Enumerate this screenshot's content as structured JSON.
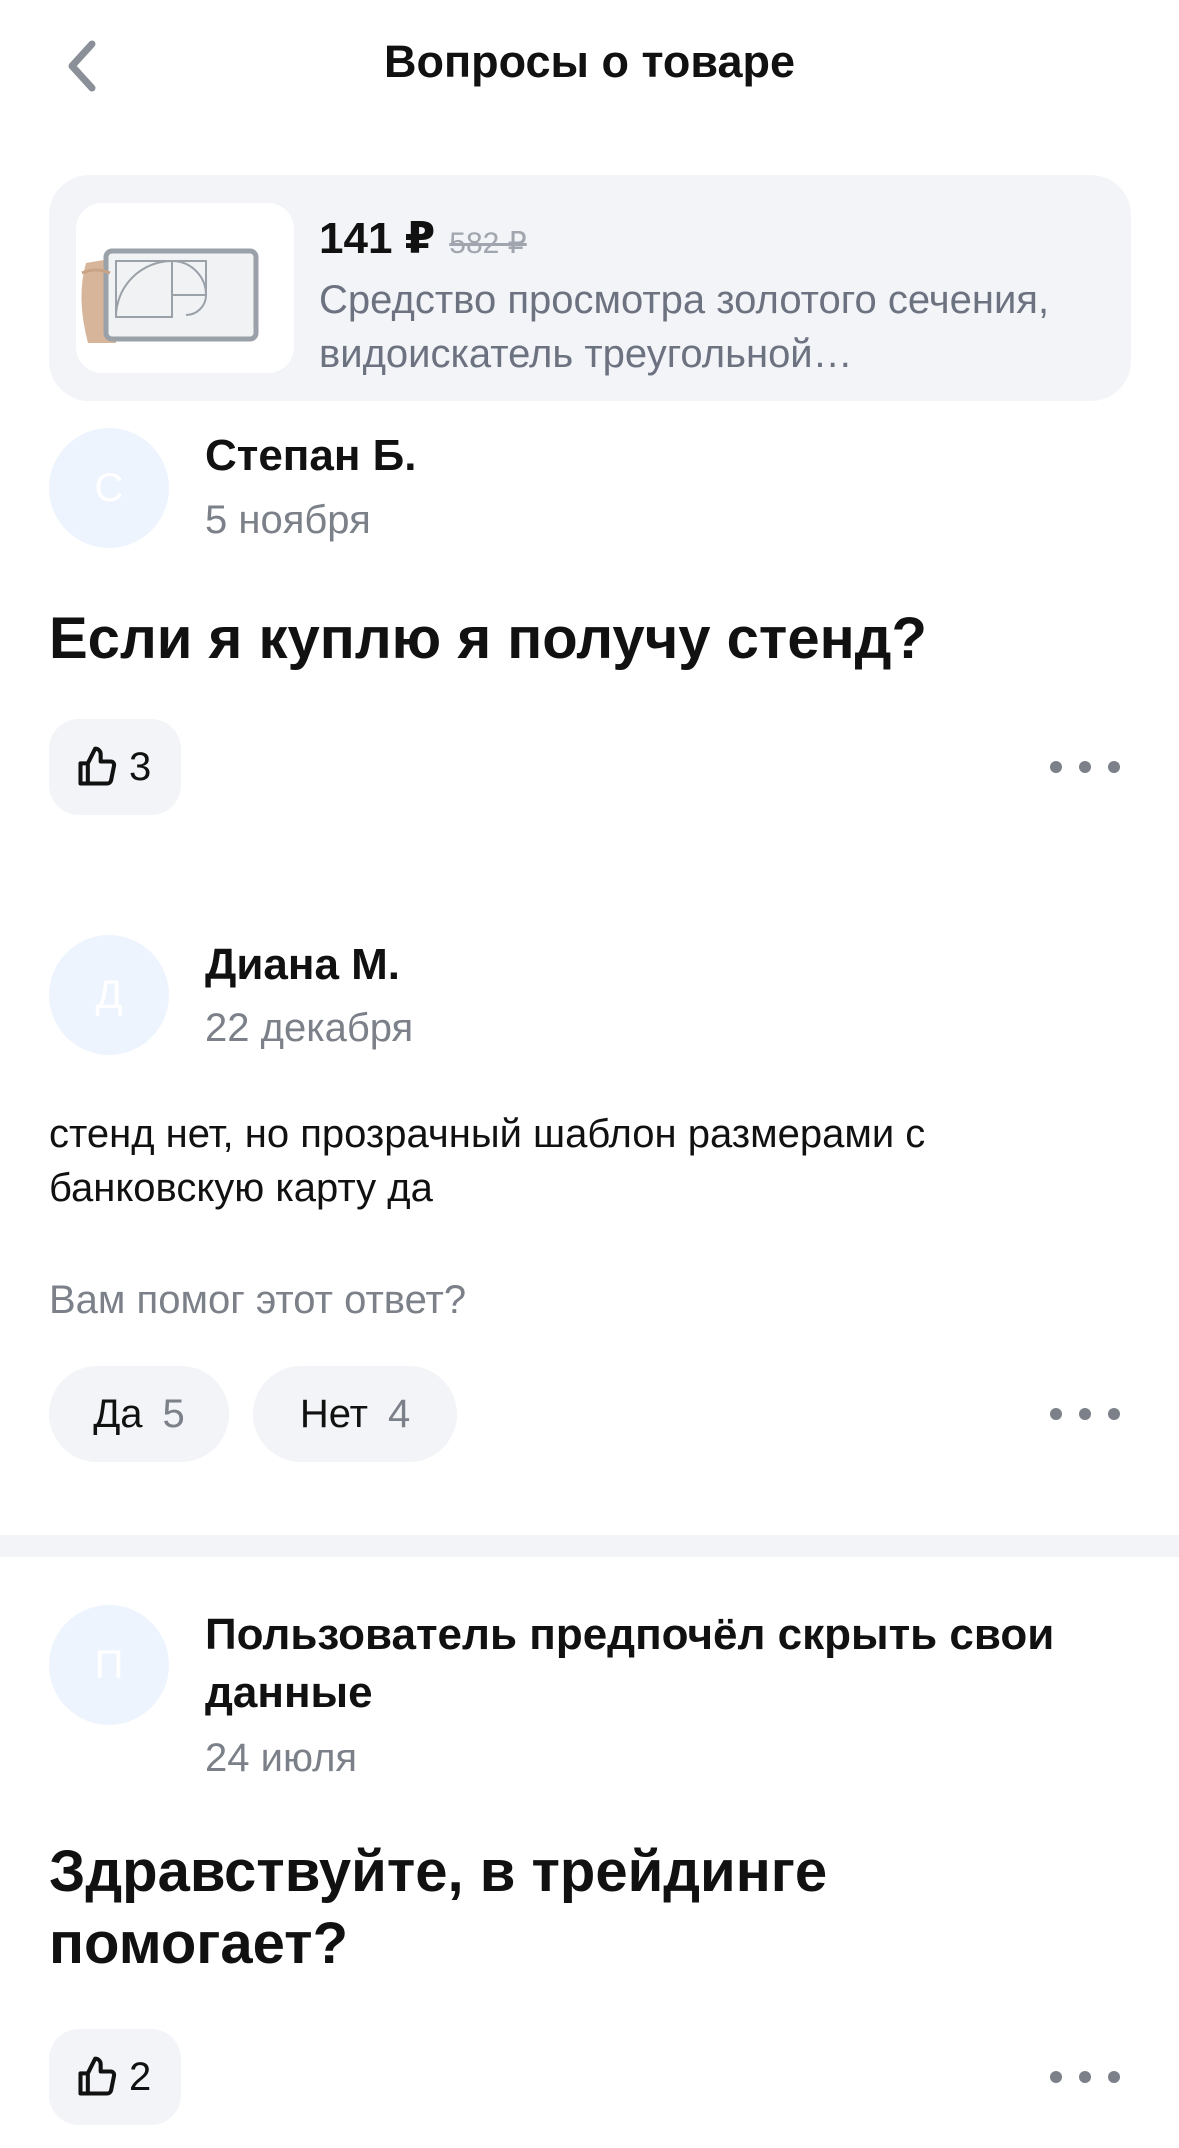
{
  "header": {
    "title": "Вопросы о товаре"
  },
  "product": {
    "price": "141 ₽",
    "old_price": "582 ₽",
    "name": "Средство просмотра золотого сечения, видоискатель треугольной…"
  },
  "items": [
    {
      "type": "question",
      "avatar_letter": "С",
      "author": "Степан Б.",
      "date": "5 ноября",
      "text": "Если я куплю я получу стенд?",
      "likes": "3"
    },
    {
      "type": "answer",
      "avatar_letter": "Д",
      "author": "Диана М.",
      "date": "22 декабря",
      "text": "стенд нет, но прозрачный шаблон размерами с банковскую карту да",
      "helpful_label": "Вам помог этот ответ?",
      "yes_label": "Да",
      "yes_count": "5",
      "no_label": "Нет",
      "no_count": "4"
    },
    {
      "type": "question",
      "avatar_letter": "П",
      "author": "Пользователь предпочёл скрыть свои данные",
      "date": "24 июля",
      "text": "Здравствуйте, в трейдинге помогает?",
      "likes": "2"
    }
  ],
  "icons": {
    "back": "chevron-left-icon",
    "like": "thumbs-up-icon",
    "more": "more-horizontal-icon"
  },
  "colors": {
    "card_bg": "#f2f4f8",
    "avatar_bg": "#edf4fd",
    "muted_text": "#7b8089"
  }
}
